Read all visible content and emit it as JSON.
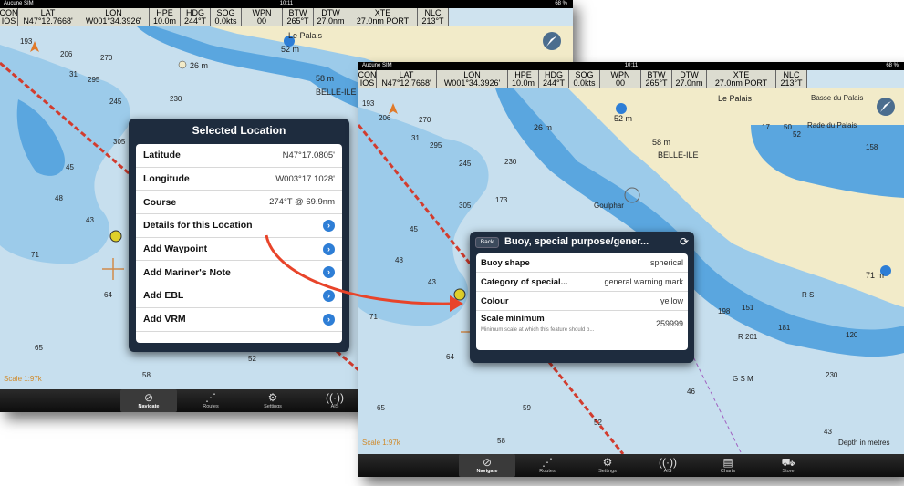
{
  "status_bar": {
    "carrier": "Aucune SIM",
    "time": "10:11",
    "battery": "68 %"
  },
  "nav_cells": [
    {
      "label": "CON",
      "value": "IOS"
    },
    {
      "label": "LAT",
      "value": "N47°12.7668'"
    },
    {
      "label": "LON",
      "value": "W001°34.3926'"
    },
    {
      "label": "HPE",
      "value": "10.0m"
    },
    {
      "label": "HDG",
      "value": "244°T"
    },
    {
      "label": "SOG",
      "value": "0.0kts"
    },
    {
      "label": "WPN",
      "value": "00"
    },
    {
      "label": "BTW",
      "value": "265°T"
    },
    {
      "label": "DTW",
      "value": "27.0nm"
    },
    {
      "label": "XTE",
      "value": "27.0nm PORT"
    },
    {
      "label": "NLC",
      "value": "213°T"
    }
  ],
  "map": {
    "place_labels": {
      "le_palais": "Le Palais",
      "basse_du_palais": "Basse du Palais",
      "rade_du_palais": "Rade du Palais",
      "belle_ile": "BELLE-ILE",
      "goulphar": "Goulphar",
      "rs": "R S",
      "gsm": "G S M",
      "height_26": "26 m",
      "height_52": "52 m",
      "height_58": "58 m",
      "height_71": "71 m"
    },
    "scale_label": "Scale 1:97k",
    "depth_units": "Depth in metres",
    "depths_left": [
      "193",
      "206",
      "270",
      "31",
      "295",
      "245",
      "230",
      "305",
      "45",
      "48",
      "43",
      "71",
      "64",
      "65",
      "58",
      "52"
    ],
    "depths_right": [
      "193",
      "206",
      "270",
      "31",
      "295",
      "245",
      "230",
      "173",
      "305",
      "45",
      "48",
      "43",
      "71",
      "64",
      "65",
      "59",
      "52",
      "58",
      "43",
      "198",
      "151",
      "181",
      "R 201",
      "120",
      "230",
      "158",
      "17",
      "50",
      "52",
      "46"
    ]
  },
  "popover_location": {
    "title": "Selected Location",
    "rows": [
      {
        "label": "Latitude",
        "value": "N47°17.0805'"
      },
      {
        "label": "Longitude",
        "value": "W003°17.1028'"
      },
      {
        "label": "Course",
        "value": "274°T @ 69.9nm"
      },
      {
        "label": "Details for this Location",
        "value": ""
      },
      {
        "label": "Add Waypoint",
        "value": ""
      },
      {
        "label": "Add Mariner's Note",
        "value": ""
      },
      {
        "label": "Add EBL",
        "value": ""
      },
      {
        "label": "Add VRM",
        "value": ""
      }
    ]
  },
  "popover_buoy": {
    "back_label": "Back",
    "title": "Buoy, special purpose/gener...",
    "rows": [
      {
        "label": "Buoy shape",
        "value": "spherical"
      },
      {
        "label": "Category of special...",
        "value": "general warning mark"
      },
      {
        "label": "Colour",
        "value": "yellow"
      },
      {
        "label": "Scale minimum",
        "sublabel": "Minimum scale at which this feature should b...",
        "value": "259999"
      }
    ]
  },
  "tabs_left": [
    {
      "label": "Navigate",
      "icon": "compass-icon",
      "glyph": "⊘"
    },
    {
      "label": "Routes",
      "icon": "routes-icon",
      "glyph": "⋰"
    },
    {
      "label": "Settings",
      "icon": "gear-icon",
      "glyph": "⚙"
    },
    {
      "label": "AIS",
      "icon": "antenna-icon",
      "glyph": "((·))"
    }
  ],
  "tabs_right": [
    {
      "label": "Navigate",
      "icon": "compass-icon",
      "glyph": "⊘"
    },
    {
      "label": "Routes",
      "icon": "routes-icon",
      "glyph": "⋰"
    },
    {
      "label": "Settings",
      "icon": "gear-icon",
      "glyph": "⚙"
    },
    {
      "label": "AIS",
      "icon": "antenna-icon",
      "glyph": "((·))"
    },
    {
      "label": "Charts",
      "icon": "charts-icon",
      "glyph": "▤"
    },
    {
      "label": "Store",
      "icon": "cart-icon",
      "glyph": "⛟"
    }
  ],
  "colors": {
    "land": "#f2ebc9",
    "shallow": "#5aa6df",
    "medium": "#9ccbea",
    "deep": "#c7dfee",
    "route_line": "#d23c2e",
    "arrow": "#e8442a",
    "popover": "#1e2c3e",
    "accent": "#2e7ed6"
  }
}
